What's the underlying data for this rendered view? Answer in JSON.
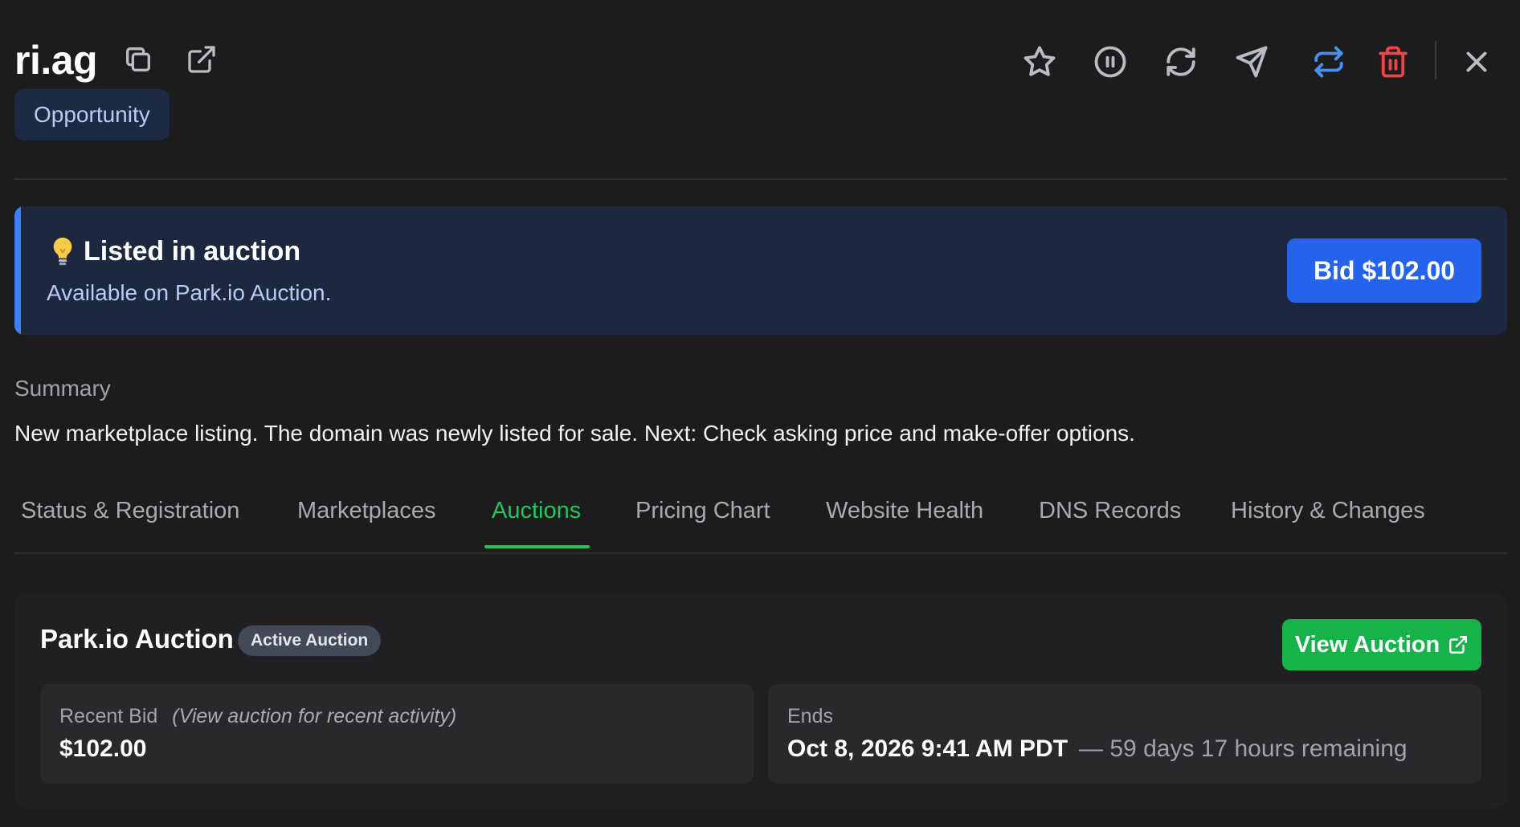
{
  "header": {
    "domain": "ri.ag",
    "badge": "Opportunity"
  },
  "colors": {
    "background": "#1c1c1d",
    "accent_blue": "#2563eb",
    "accent_green": "#22c55e",
    "delete_red": "#ef4444"
  },
  "icons": {
    "copy": "copy-icon",
    "open_external": "external-link-icon",
    "favorite": "star-icon",
    "pause": "pause-icon",
    "refresh": "refresh-icon",
    "send": "send-icon",
    "transfer": "transfer-icon",
    "delete": "trash-icon",
    "close": "close-icon",
    "alert": "lightbulb-icon"
  },
  "alert": {
    "title": "Listed in auction",
    "subtitle": "Available on Park.io Auction.",
    "bid_button": "Bid $102.00"
  },
  "summary": {
    "label": "Summary",
    "text": "New marketplace listing. The domain was newly listed for sale. Next: Check asking price and make-offer options."
  },
  "tabs": [
    {
      "label": "Status & Registration",
      "active": false
    },
    {
      "label": "Marketplaces",
      "active": false
    },
    {
      "label": "Auctions",
      "active": true
    },
    {
      "label": "Pricing Chart",
      "active": false
    },
    {
      "label": "Website Health",
      "active": false
    },
    {
      "label": "DNS Records",
      "active": false
    },
    {
      "label": "History & Changes",
      "active": false
    }
  ],
  "auction": {
    "title": "Park.io Auction",
    "status": "Active Auction",
    "view_button": "View Auction",
    "recent_bid": {
      "label": "Recent Bid",
      "note": "(View auction for recent activity)",
      "value": "$102.00"
    },
    "ends": {
      "label": "Ends",
      "value": "Oct 8, 2026 9:41 AM PDT",
      "remaining": "— 59 days 17 hours remaining"
    }
  }
}
